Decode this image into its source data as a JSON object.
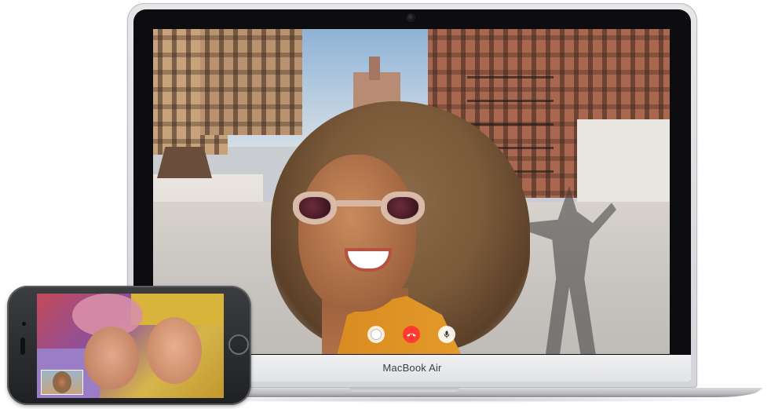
{
  "laptop": {
    "brand_label": "MacBook Air"
  },
  "facetime_call": {
    "controls": [
      {
        "name": "capture-photo",
        "icon": "shutter-icon"
      },
      {
        "name": "end-call",
        "icon": "phone-hangup-icon",
        "color": "#ff3b30"
      },
      {
        "name": "mute",
        "icon": "microphone-icon"
      }
    ]
  },
  "phone": {
    "icons": [
      "home-button-icon",
      "front-camera-icon"
    ]
  }
}
